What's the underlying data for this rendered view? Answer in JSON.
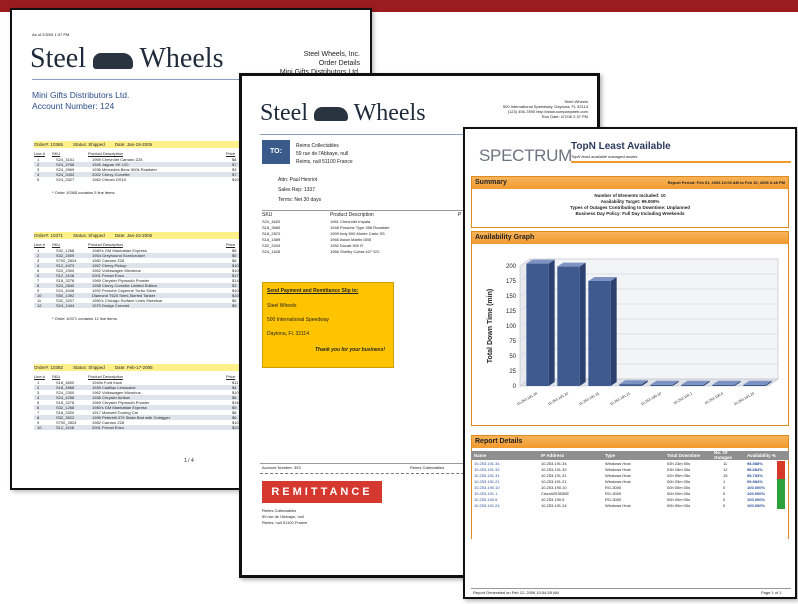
{
  "doc1": {
    "timestamp": "As of 2/3/05 1:37 PM",
    "logo_left": "Steel",
    "logo_right": "Wheels",
    "company": "Steel Wheels, Inc.",
    "report_title": "Order Details",
    "customer_right": "Mini Gifts Distributors Ltd.",
    "customer_name": "Mini Gifts Distributors Ltd.",
    "account_number": "Account Number:  124",
    "col_line": "Line #",
    "col_sku": "SKU",
    "col_desc": "Product Description",
    "col_price": "Price",
    "orders": [
      {
        "order": "Order#:  10365",
        "status": "Status: Shipped",
        "date": "Date:  Jan-19-2005",
        "footer": "* Order 10365 contains  5 line items.",
        "rows": [
          [
            "1",
            "S24_3151",
            "1969 Chevrolet Camaro Z28",
            "$8"
          ],
          [
            "2",
            "S24_3766",
            "1949 Jaguar XK 120",
            "$7"
          ],
          [
            "3",
            "S24_3969",
            "1936 Mercedes Benz 500k Roadster",
            "$3"
          ],
          [
            "4",
            "S24_3432",
            "2002 Chevy Corvette",
            "$7"
          ],
          [
            "5",
            "S24_3327",
            "1962 Citroen DS19",
            "$10"
          ]
        ]
      },
      {
        "order": "Order#:  10371",
        "status": "Status: Shipped",
        "date": "Date:  Jan-23-2005",
        "footer": "* Order 10371 contains  12 line items.",
        "rows": [
          [
            "1",
            "S32_1268",
            "1980's GM Manhattan Express",
            "$8"
          ],
          [
            "2",
            "S32_2509",
            "1954 Greyhound Scenicruiser",
            "$5"
          ],
          [
            "3",
            "S700_2824",
            "1982 Camaro Z28",
            "$8"
          ],
          [
            "4",
            "S12_4473",
            "1957 Chevy Pickup",
            "$10"
          ],
          [
            "5",
            "S24_2300",
            "1962 Volkswagen Microbus",
            "$10"
          ],
          [
            "6",
            "S12_1108",
            "2001 Ferrari Enzo",
            "$17"
          ],
          [
            "7",
            "S18_3278",
            "1969 Chrysler Plymouth Prowler",
            "$14"
          ],
          [
            "8",
            "S24_2840",
            "1958 Chevy Corvette Limited Edition",
            "$3"
          ],
          [
            "9",
            "S24_4048",
            "1992 Porsche Cayenne Turbo Silver",
            "$10"
          ],
          [
            "10",
            "S50_1392",
            "Diamond T620 Semi-Skirted Tanker",
            "$10"
          ],
          [
            "11",
            "S32_3207",
            "1950's Chicago Surface Lines Streetcar",
            "$6"
          ],
          [
            "12",
            "S24_1444",
            "1970 Dodge Coronet",
            "$5"
          ]
        ]
      },
      {
        "order": "Order#:  10382",
        "status": "Status: Shipped",
        "date": "Date:  Feb-17-2005",
        "footer": "",
        "rows": [
          [
            "1",
            "S18_4600",
            "1940s Ford truck",
            "$11"
          ],
          [
            "2",
            "S18_4668",
            "1939 Cadillac Limousine",
            "$4"
          ],
          [
            "3",
            "S24_2300",
            "1962 Volkswagen Microbus",
            "$10"
          ],
          [
            "4",
            "S24_4258",
            "1936 Chrysler Airflow",
            "$8"
          ],
          [
            "5",
            "S18_3278",
            "1969 Chrysler Plymouth Prowler",
            "$16"
          ],
          [
            "6",
            "S32_1268",
            "1980's GM Manhattan Express",
            "$9"
          ],
          [
            "7",
            "S18_3320",
            "1917 Maxwell Touring Car",
            "$8"
          ],
          [
            "8",
            "S32_3522",
            "1996 Peterbilt 379 Stake Bed with Outrigger",
            "$6"
          ],
          [
            "9",
            "S700_2824",
            "1982 Camaro Z28",
            "$10"
          ],
          [
            "10",
            "S12_1108",
            "2001 Ferrari Enzo",
            "$20"
          ]
        ]
      }
    ],
    "page_number": "1 / 4"
  },
  "doc2": {
    "logo_left": "Steel",
    "logo_right": "Wheels",
    "addr_company": "Steel Wheels",
    "addr_street": "500 International Speedway, Daytona, FL  32114",
    "addr_contact": "(123) 456-7890 http://www.companyweb.com",
    "run_date": "Run Date: 2/7/06 2:37 PM",
    "to_label": "TO:",
    "to_name": "Reims Collectables",
    "to_street": "59 rue de l'Abbaye, null",
    "to_city": "Reims, null  51100   France",
    "attn": "Attn: Paul Henriot",
    "sales_rep": "Sales Rep:  1337",
    "terms": "Terms: Net 30 days",
    "col_sku": "SKU",
    "col_desc": "Product Description",
    "col_p": "P",
    "rows": [
      [
        "S24_4620",
        "1961 Chevrolet Impala"
      ],
      [
        "S18_3685",
        "1948 Porsche Type 356 Roadster"
      ],
      [
        "S18_2870",
        "1999 Indy 500 Monte Carlo SS"
      ],
      [
        "S18_1589",
        "1965 Aston Martin DB5"
      ],
      [
        "S32_3204",
        "1992 Ducati 900 R"
      ],
      [
        "S24_1628",
        "1966 Shelby Cobra 427 S/C"
      ]
    ],
    "remit_title": "Send Payment and Remittance Slip to:",
    "remit_company": "Steel Wheels",
    "remit_street": "500 International Speedway",
    "remit_city": "Daytona, FL  32114",
    "remit_thanks": "Thank you for your business!",
    "footer_account": "Account Number:  353",
    "footer_customer": "Reims Collectables",
    "remittance": "REMITTANCE",
    "bottom_name": "Reims Collectables",
    "bottom_street": "59 rue de l'Abbaye, null",
    "bottom_city": "Reims, null  51100   France"
  },
  "doc3": {
    "brand": "SPECTRUM",
    "title": "TopN Least Available",
    "subtitle": "TopN least available managed assets",
    "summary_label": "Summary",
    "report_period": "Report Period:  Feb 01, 2006 12:00 AM to Feb 10, 2006 6:48 PM",
    "summary_lines": [
      "Number of Elements Included: 10",
      "Availability Target: 99.000%",
      "Types of Outages Contributing to Downtime: Unplanned",
      "Business Day Policy: Full Day Including Weekends"
    ],
    "graph_label": "Availability Graph",
    "details_label": "Report Details",
    "col_name": "Name",
    "col_ip": "IP Address",
    "col_type": "Type",
    "col_downtime": "Total Downtime",
    "col_outages": "No. Of Outages",
    "col_avail": "Availability %",
    "rows": [
      {
        "name": "10.253.191.34",
        "ip": "10.253.191.34",
        "type": "Windows Host",
        "downtime": "03h 23m 50s",
        "outages": "11",
        "avail": "98.588%",
        "status": "#d83a2a"
      },
      {
        "name": "10.253.191.32",
        "ip": "10.253.191.32",
        "type": "Windows Host",
        "downtime": "03h 18m 30s",
        "outages": "12",
        "avail": "98.684%",
        "status": "#d83a2a"
      },
      {
        "name": "10.253.191.31",
        "ip": "10.253.191.31",
        "type": "Windows Host",
        "downtime": "02h 55m 05s",
        "outages": "15",
        "avail": "98.783%",
        "status": "#d83a2a"
      },
      {
        "name": "10.253.191.21",
        "ip": "10.253.191.21",
        "type": "Windows Host",
        "downtime": "00h 03m 00s",
        "outages": "1",
        "avail": "99.984%",
        "status": "#2ca23a"
      },
      {
        "name": "10.253.190.10",
        "ip": "10.253.190.10",
        "type": "RG-3000",
        "downtime": "00h 00m 00s",
        "outages": "0",
        "avail": "100.000%",
        "status": "#2ca23a"
      },
      {
        "name": "10.253.191.1",
        "ip": "CiscoWS3530E",
        "type": "RG-3000",
        "downtime": "00h 00m 00s",
        "outages": "0",
        "avail": "100.000%",
        "status": "#2ca23a"
      },
      {
        "name": "10.253.190.5",
        "ip": "10.253.190.5",
        "type": "RG-3000",
        "downtime": "00h 00m 00s",
        "outages": "0",
        "avail": "100.000%",
        "status": "#2ca23a"
      },
      {
        "name": "10.253.191.24",
        "ip": "10.253.191.24",
        "type": "Windows Host",
        "downtime": "00h 00m 00s",
        "outages": "0",
        "avail": "100.000%",
        "status": "#2ca23a"
      }
    ],
    "footer_generated": "Report Generated on Feb 12, 2006 10:54:55 AM",
    "footer_page": "Page 1 of 1"
  },
  "chart_data": {
    "type": "bar",
    "title": "",
    "ylabel": "Total Down Time (min)",
    "xlabel": "",
    "ylim": [
      0,
      200
    ],
    "yticks": [
      0,
      25,
      50,
      75,
      100,
      125,
      150,
      175,
      200
    ],
    "categories": [
      "10.253.191.34",
      "10.253.191.32",
      "10.253.191.31",
      "10.253.191.21",
      "10.253.190.10",
      "10.253.191.1",
      "10.253.190.5",
      "10.253.191.24"
    ],
    "values": [
      204,
      199,
      175,
      3,
      0,
      0,
      0,
      0
    ],
    "bar_color": "#3f5a8f",
    "grid": true
  }
}
